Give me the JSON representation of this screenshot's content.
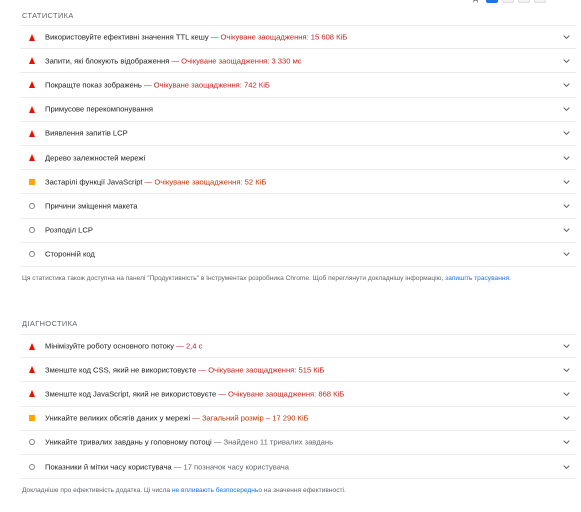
{
  "toolbar": {
    "view_label": "Д"
  },
  "insights": {
    "title": "СТАТИСТИКА",
    "items": [
      {
        "icon": "fail-triangle-icon",
        "label": "Використовуйте ефективні значення TTL кешу",
        "separator": " — ",
        "display": "Очікуване заощадження: 15 608 КіБ",
        "display_class": "fail"
      },
      {
        "icon": "fail-triangle-icon",
        "label": "Запити, які блокують відображення",
        "separator": " — ",
        "display": "Очікуване заощадження: 3 330 мс",
        "display_class": "fail"
      },
      {
        "icon": "fail-triangle-icon",
        "label": "Покращте показ зображень",
        "separator": " — ",
        "display": "Очікуване заощадження: 742 КіБ",
        "display_class": "fail"
      },
      {
        "icon": "fail-triangle-icon",
        "label": "Примусове перекомпонування",
        "separator": "",
        "display": "",
        "display_class": "fail"
      },
      {
        "icon": "fail-triangle-icon",
        "label": "Виявлення запитів LCP",
        "separator": "",
        "display": "",
        "display_class": "fail"
      },
      {
        "icon": "fail-triangle-icon",
        "label": "Дерево залежностей мережі",
        "separator": "",
        "display": "",
        "display_class": "fail"
      },
      {
        "icon": "average-square-icon",
        "label": "Застарілі функції JavaScript",
        "separator": " — ",
        "display": "Очікуване заощадження: 52 КіБ",
        "display_class": "avg"
      },
      {
        "icon": "info-circle-icon",
        "label": "Причини зміщення макета",
        "separator": "",
        "display": "",
        "display_class": "info"
      },
      {
        "icon": "info-circle-icon",
        "label": "Розподіл LCP",
        "separator": "",
        "display": "",
        "display_class": "info"
      },
      {
        "icon": "info-circle-icon",
        "label": "Сторонній код",
        "separator": "",
        "display": "",
        "display_class": "info"
      }
    ],
    "note_prefix": "Ця статистика також доступна на панелі \"Продуктивність\" в Інструментах розробника Chrome. Щоб переглянути докладнішу інформацію, ",
    "note_link": "запишіть трасування",
    "note_suffix": "."
  },
  "diagnostics": {
    "title": "ДІАГНОСТИКА",
    "items": [
      {
        "icon": "fail-triangle-icon",
        "label": "Мінімізуйте роботу основного потоку",
        "separator": " — ",
        "display": "2,4 с",
        "display_class": "fail"
      },
      {
        "icon": "fail-triangle-icon",
        "label": "Зменште код CSS, який не використовуєте",
        "separator": " — ",
        "display": "Очікуване заощадження: 515 КіБ",
        "display_class": "fail"
      },
      {
        "icon": "fail-triangle-icon",
        "label": "Зменште код JavaScript, який не використовуєте",
        "separator": " — ",
        "display": "Очікуване заощадження: 868 КіБ",
        "display_class": "fail"
      },
      {
        "icon": "average-square-icon",
        "label": "Уникайте великих обсягів даних у мережі",
        "separator": " — ",
        "display": "Загальний розмір – 17 290 КіБ",
        "display_class": "avg"
      },
      {
        "icon": "info-circle-icon",
        "label": "Уникайте тривалих завдань у головному потоці",
        "separator": " — ",
        "display": "Знайдено 11 тривалих завдань",
        "display_class": "info"
      },
      {
        "icon": "info-circle-icon",
        "label": "Показники й мітки часу користувача",
        "separator": " — ",
        "display": "17 позначок часу користувача",
        "display_class": "info"
      }
    ],
    "note_prefix": "Докладніше про ефективність додатка. Ці числа ",
    "note_link": "не впливають безпосередньо",
    "note_suffix": " на значення ефективності."
  }
}
